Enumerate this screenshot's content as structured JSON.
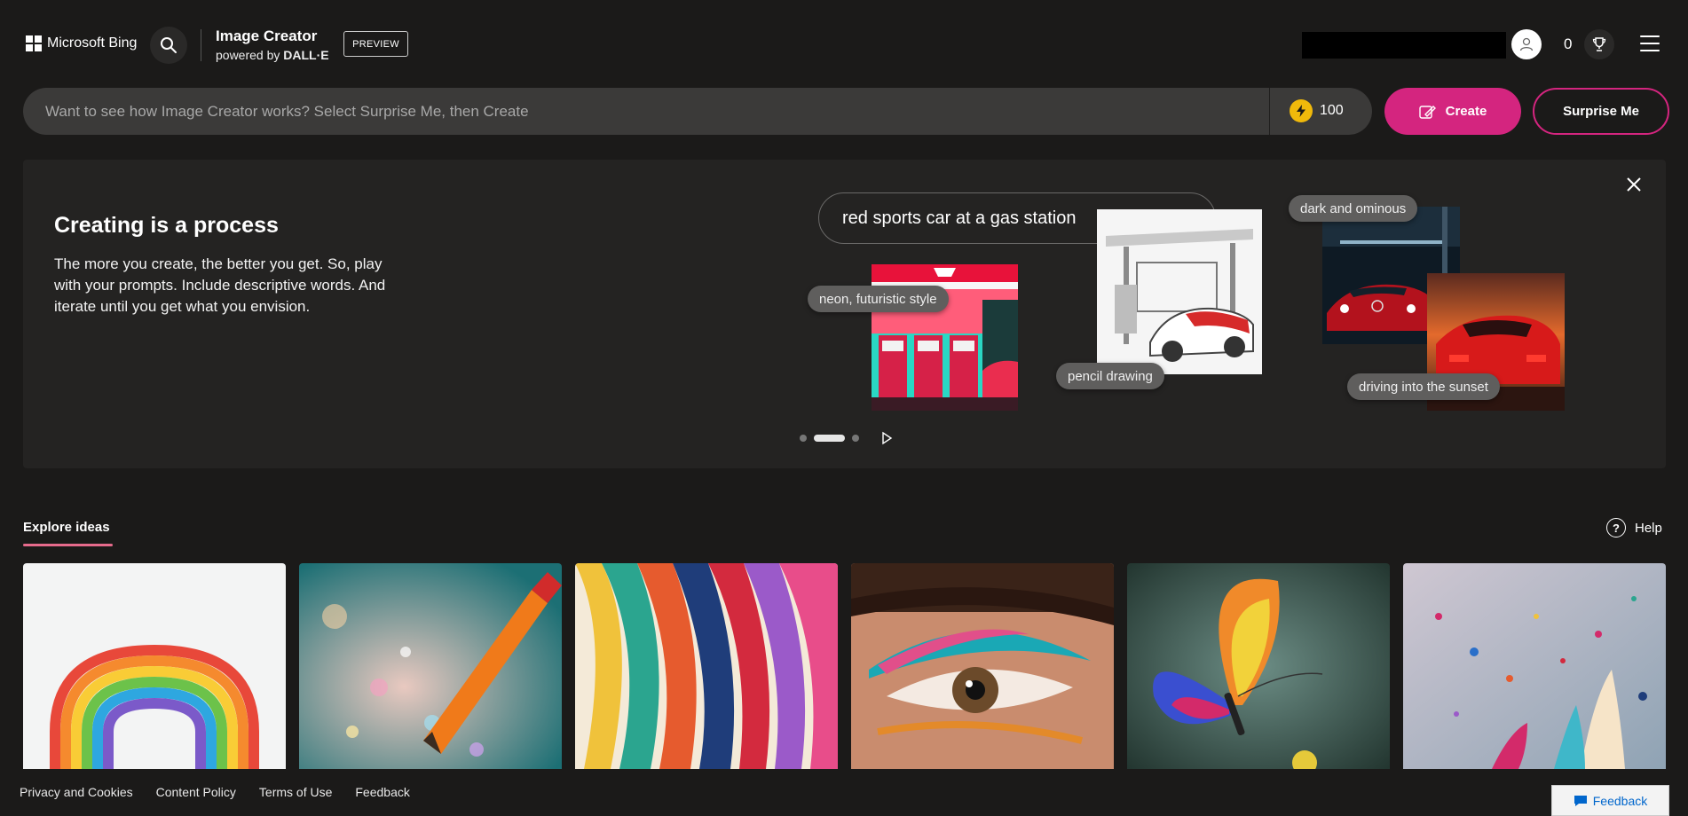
{
  "header": {
    "brand": "Microsoft Bing",
    "product_title": "Image Creator",
    "product_sub_prefix": "powered by",
    "product_sub_bold": "DALL·E",
    "badge": "PREVIEW",
    "reward_count": "0"
  },
  "prompt": {
    "placeholder": "Want to see how Image Creator works? Select Surprise Me, then Create",
    "boost_count": "100",
    "create_label": "Create",
    "surprise_label": "Surprise Me"
  },
  "banner": {
    "title": "Creating is a process",
    "text": "The more you create, the better you get. So, play with your prompts. Include descriptive words. And iterate until you get what you envision.",
    "demo_prompt": "red sports car at a gas station",
    "chips": [
      "neon, futuristic style",
      "pencil drawing",
      "dark and ominous",
      "driving into the sunset"
    ],
    "carousel_active": 2,
    "carousel_total": 3
  },
  "explore": {
    "tab_label": "Explore ideas",
    "help_label": "Help"
  },
  "footer": {
    "links": [
      "Privacy and Cookies",
      "Content Policy",
      "Terms of Use",
      "Feedback"
    ],
    "feedback_button": "Feedback"
  },
  "colors": {
    "accent": "#d4257f",
    "background": "#1b1a19",
    "panel": "#242322",
    "coin": "#f0b90b"
  }
}
